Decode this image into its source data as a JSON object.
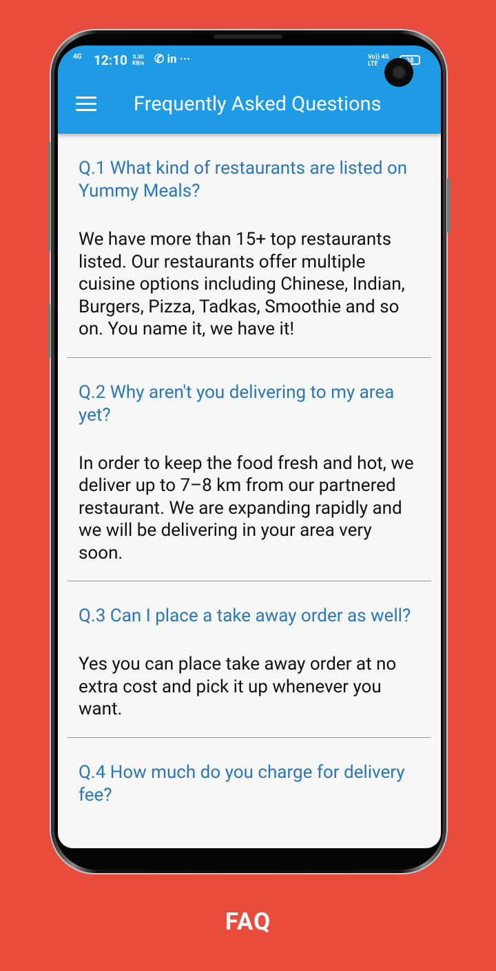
{
  "status_bar": {
    "network": "4G",
    "time": "12:10",
    "speed_value": "0.30",
    "speed_unit": "KB/s",
    "app_icons": "✆ in ···",
    "right_indicators": "Vo)) 4G\nLTE",
    "battery": "38"
  },
  "toolbar": {
    "title": "Frequently Asked Questions"
  },
  "faq": [
    {
      "question": "Q.1 What kind of restaurants are listed on Yummy Meals?",
      "answer": "We have more than 15+ top restaurants listed. Our restaurants offer multiple cuisine options including Chinese, Indian, Burgers, Pizza, Tadkas, Smoothie and so on. You name it, we have it!"
    },
    {
      "question": "Q.2 Why aren't you delivering to my area yet?",
      "answer": "In order to keep the food fresh and hot, we deliver up to 7–8 km from our partnered restaurant. We are expanding rapidly and we will be delivering in your area very soon."
    },
    {
      "question": "Q.3 Can I place a take away order as well?",
      "answer": "Yes you can place take away order at no extra cost and pick it up whenever you want."
    },
    {
      "question": "Q.4 How much do you charge for delivery fee?",
      "answer": ""
    }
  ],
  "caption": "FAQ",
  "colors": {
    "background": "#E84C3D",
    "toolbar": "#1E9BE4",
    "question_text": "#2A77B8",
    "answer_text": "#111111"
  },
  "icons": {
    "menu": "hamburger-menu-icon"
  }
}
